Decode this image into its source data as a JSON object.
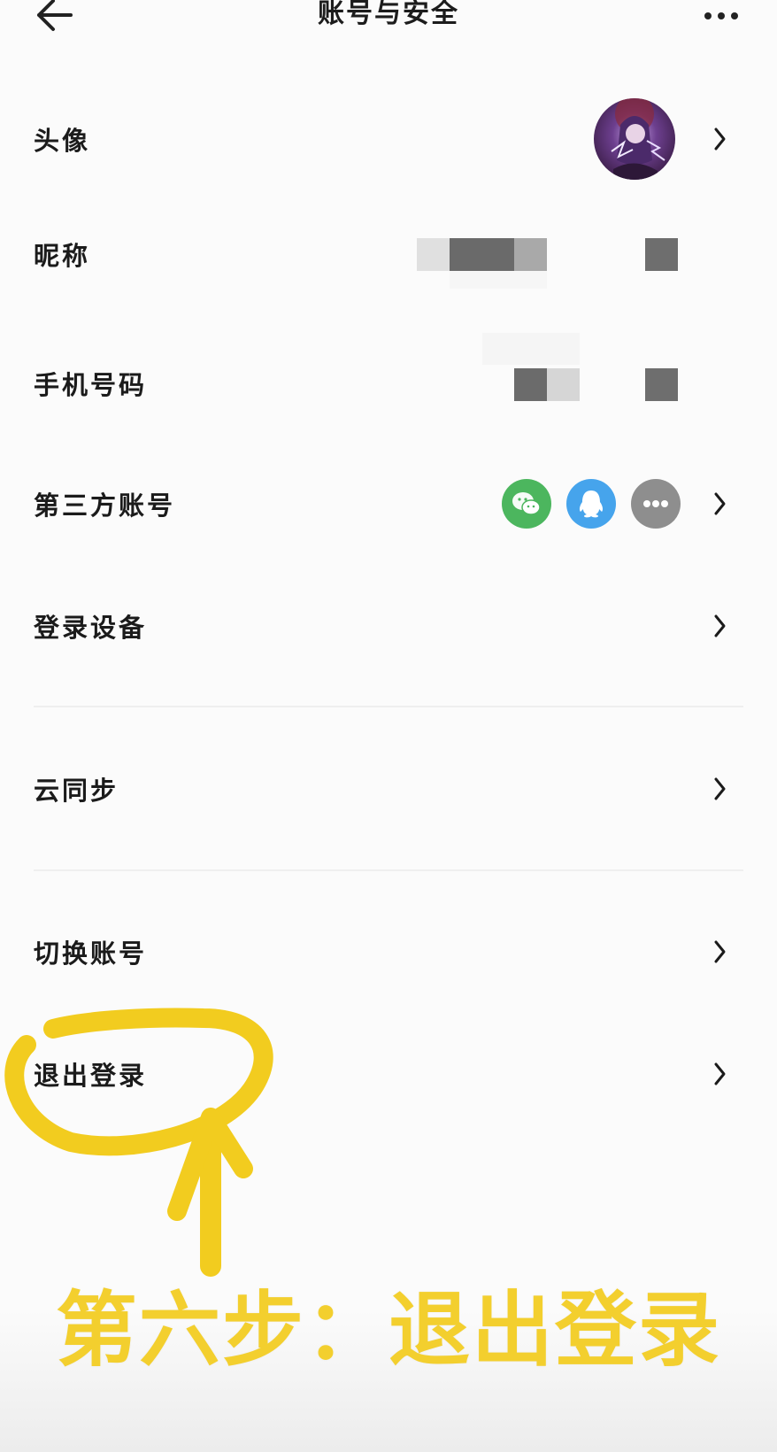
{
  "header": {
    "title": "账号与安全"
  },
  "rows": {
    "avatar": {
      "label": "头像"
    },
    "nickname": {
      "label": "昵称"
    },
    "phone": {
      "label": "手机号码"
    },
    "third_party": {
      "label": "第三方账号"
    },
    "devices": {
      "label": "登录设备"
    },
    "cloud_sync": {
      "label": "云同步"
    },
    "switch_account": {
      "label": "切换账号"
    },
    "logout": {
      "label": "退出登录"
    }
  },
  "icons": {
    "back": "arrow-left-icon",
    "more": "more-dots-icon",
    "chevron": "chevron-right-icon",
    "wechat": "wechat-icon",
    "qq": "qq-icon",
    "more_accounts": "more-dots-icon"
  },
  "colors": {
    "wechat": "#4cb65e",
    "qq": "#46a4ec",
    "more_accounts": "#8e8e8e",
    "annotation": "#f3cf2e"
  },
  "annotation": {
    "caption": "第六步：退出登录"
  }
}
